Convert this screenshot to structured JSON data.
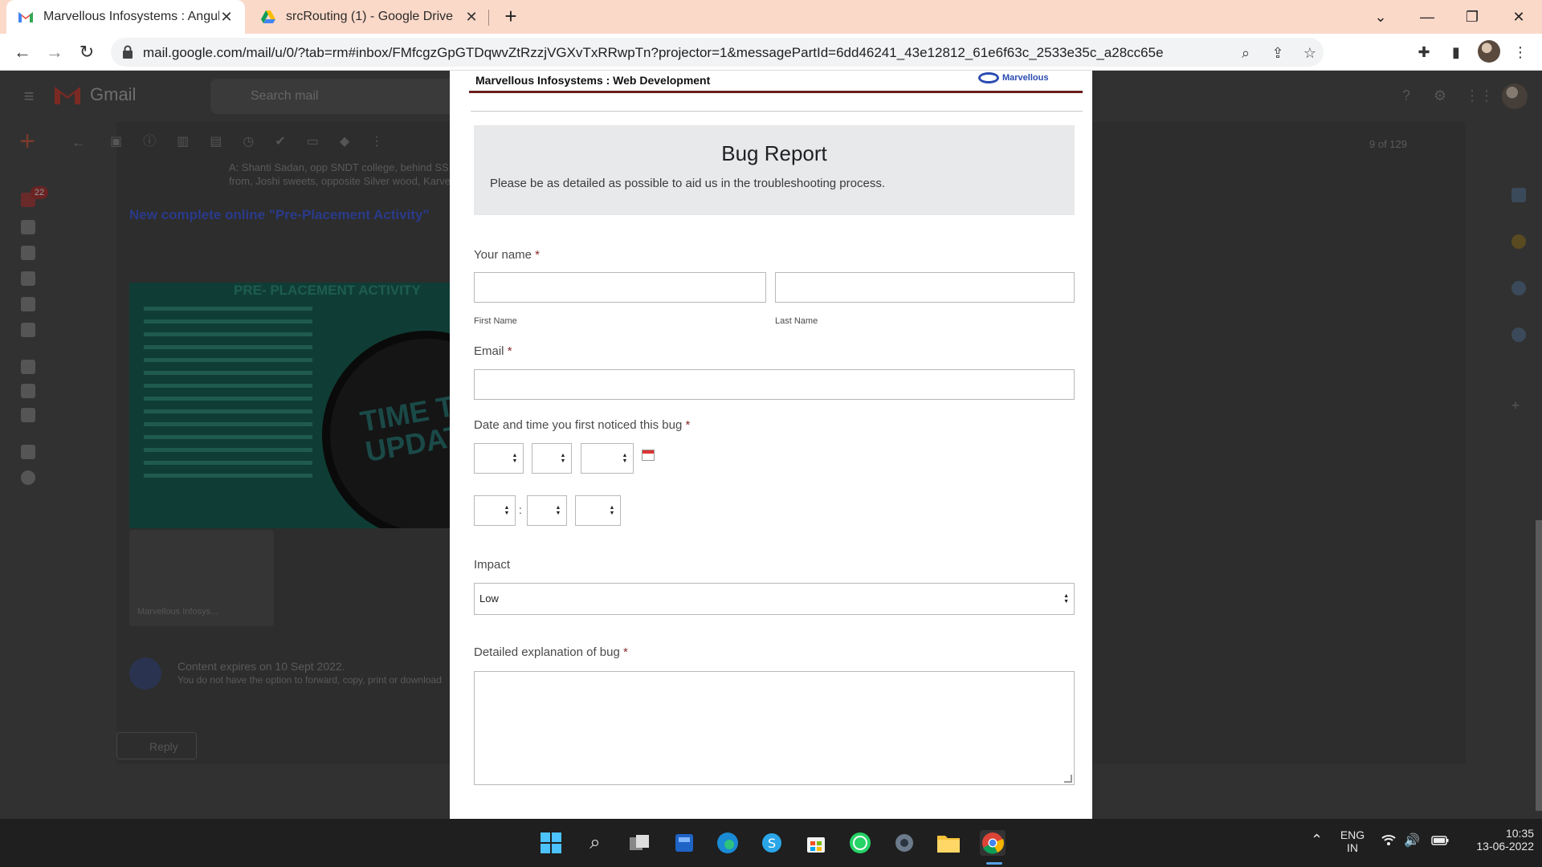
{
  "browser": {
    "tabs": [
      {
        "title": "Marvellous Infosystems : Angular",
        "icon": "gmail-icon"
      },
      {
        "title": "srcRouting (1) - Google Drive",
        "icon": "google-drive-icon"
      }
    ],
    "url": "mail.google.com/mail/u/0/?tab=rm#inbox/FMfcgzGpGTDqwvZtRzzjVGXvTxRRwpTn?projector=1&messagePartId=6dd46241_43e12812_61e6f63c_2533e35c_a28cc65e"
  },
  "gmail_background": {
    "app_name": "Gmail",
    "search_placeholder": "Search mail",
    "pager": "9 of 129",
    "unread_badge": "22",
    "address_line1": "A: Shanti Sadan, opp SNDT college, behind SS",
    "address_line2": "from, Joshi sweets, opposite Silver wood, Karve",
    "email_headline": "New complete online \"Pre-Placement Activity\"",
    "poster_title": "PRE- PLACEMENT ACTIVITY",
    "poster_clock_text": "TIME TO UPDATE",
    "attachment_name": "Marvellous Infosys...",
    "expiry_line1": "Content expires on 10 Sept 2022.",
    "expiry_line2": "You do not have the option to forward, copy, print or download",
    "reply_label": "Reply"
  },
  "document": {
    "header_org": "Marvellous Infosystems : Web Development",
    "logo_text": "Marvellous",
    "title": "Bug Report",
    "subtitle": "Please be as detailed as possible to aid us in the troubleshooting process.",
    "name_label": "Your name",
    "required_mark": "*",
    "first_name_label": "First Name",
    "last_name_label": "Last Name",
    "email_label": "Email",
    "datetime_label": "Date and time you first noticed this bug",
    "time_separator": ":",
    "impact_label": "Impact",
    "impact_value": "Low",
    "explanation_label": "Detailed explanation of bug"
  },
  "taskbar": {
    "language_top": "ENG",
    "language_bottom": "IN",
    "time": "10:35",
    "date": "13-06-2022"
  },
  "colors": {
    "tabstrip": "#fbd9c9",
    "doc_header_rule": "#6b1d1d",
    "banner_bg": "#e8e9eb",
    "taskbar": "#1f1f1f"
  }
}
